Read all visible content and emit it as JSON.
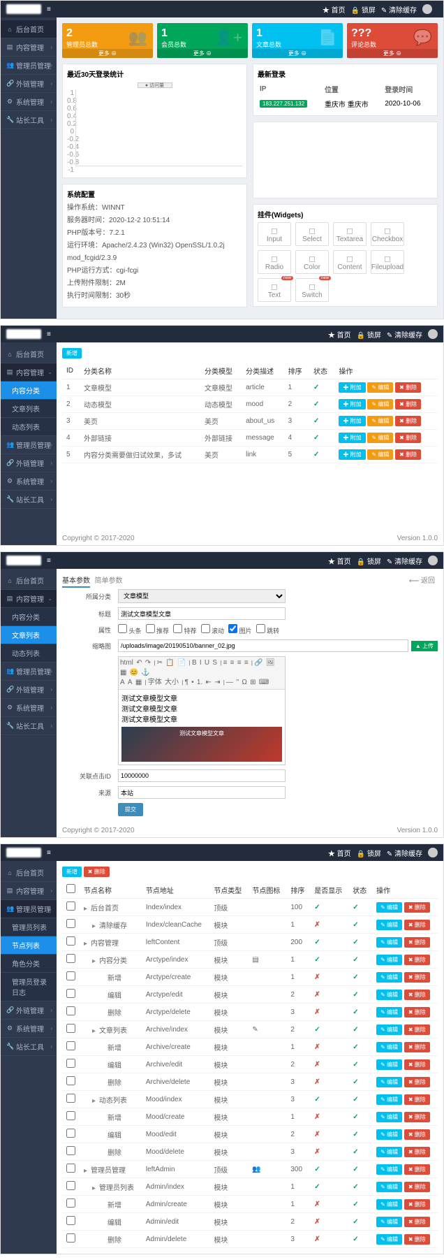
{
  "topbar": {
    "menu_icon": "≡",
    "home": "★ 首页",
    "lock": "🔒 锁屏",
    "clear": "✎ 清除缓存",
    "user": ""
  },
  "sidebar_common": {
    "dashboard": "后台首页",
    "content": "内容管理",
    "content_cat": "内容分类",
    "article_list": "文章列表",
    "dynamic_list": "动态列表",
    "admin": "管理员管理",
    "admin_list": "管理员列表",
    "node_list": "节点列表",
    "role_list": "角色分类",
    "admin_log": "管理员登录日志",
    "ext": "外链管理",
    "sys": "系统管理",
    "tools": "站长工具"
  },
  "shot1": {
    "cards": [
      {
        "num": "2",
        "label": "管理员总数",
        "color": "c-orange",
        "icon": "👥"
      },
      {
        "num": "1",
        "label": "会员总数",
        "color": "c-green",
        "icon": "👤+"
      },
      {
        "num": "1",
        "label": "文章总数",
        "color": "c-blue",
        "icon": "📄"
      },
      {
        "num": "???",
        "label": "评论总数",
        "color": "c-red",
        "icon": "💬"
      }
    ],
    "card_more": "更多 ⊕",
    "chart_title": "最近30天登录统计",
    "chart_legend": "● 访问量",
    "login_panel": "最新登录",
    "login_headers": {
      "ip": "IP",
      "loc": "位置",
      "time": "登录时间"
    },
    "login_row": {
      "ip": "183.227.251.132",
      "loc": "重庆市 重庆市",
      "time": "2020-10-06"
    },
    "sys_title": "系统配置",
    "sys_lines": [
      "操作系统：WINNT",
      "服务器时间：2020-12-2 10:51:14",
      "PHP版本号：7.2.1",
      "运行环境：Apache/2.4.23 (Win32) OpenSSL/1.0.2j mod_fcgid/2.3.9",
      "PHP运行方式：cgi-fcgi",
      "上传附件限制：2M",
      "执行时间限制：30秒"
    ],
    "widgets_title": "挂件(Widgets)",
    "widgets": [
      {
        "n": "Input",
        "new": false
      },
      {
        "n": "Select",
        "new": false
      },
      {
        "n": "Textarea",
        "new": false
      },
      {
        "n": "Checkbox",
        "new": false
      },
      {
        "n": "Radio",
        "new": false
      },
      {
        "n": "Color",
        "new": false
      },
      {
        "n": "Content",
        "new": false
      },
      {
        "n": "Fileupload",
        "new": false
      },
      {
        "n": "Text",
        "new": true
      },
      {
        "n": "Switch",
        "new": true
      }
    ],
    "chart_data": {
      "type": "line",
      "title": "最近30天登录统计",
      "series": [
        {
          "name": "访问量",
          "values": [
            0,
            0,
            0,
            0,
            0,
            0,
            0,
            0,
            0,
            0,
            0,
            0,
            0,
            0,
            0,
            0,
            0,
            0,
            0,
            0,
            0,
            0,
            0,
            0,
            0,
            0,
            0,
            0,
            0,
            0
          ]
        }
      ],
      "ylim": [
        -1,
        1
      ],
      "yticks": [
        -1,
        -0.8,
        -0.6,
        -0.4,
        -0.2,
        0,
        0.2,
        0.4,
        0.6,
        0.8,
        1
      ]
    }
  },
  "shot2": {
    "add_btn": "新增",
    "headers": {
      "id": "ID",
      "name": "分类名称",
      "type": "分类模型",
      "alias": "分类描述",
      "sort": "排序",
      "status": "状态",
      "op": "操作"
    },
    "rows": [
      {
        "id": "1",
        "name": "文章模型",
        "type": "文章模型",
        "alias": "article",
        "sort": "1",
        "status": true
      },
      {
        "id": "2",
        "name": "动态模型",
        "type": "动态模型",
        "alias": "mood",
        "sort": "2",
        "status": true
      },
      {
        "id": "3",
        "name": "美页",
        "type": "美页",
        "alias": "about_us",
        "sort": "3",
        "status": true
      },
      {
        "id": "4",
        "name": "外部链接",
        "type": "外部链接",
        "alias": "message",
        "sort": "4",
        "status": true
      },
      {
        "id": "5",
        "name": "内容分类需要做归试效果，多试",
        "type": "美页",
        "alias": "link",
        "sort": "5",
        "status": true
      }
    ],
    "op_labels": {
      "add": "✚ 附加",
      "edit": "✎ 编辑",
      "del": "✖ 删除"
    },
    "copyright": "Copyright © 2017-2020",
    "version": "Version 1.0.0"
  },
  "shot3": {
    "breadcrumb": [
      "基本参数",
      "简单参数"
    ],
    "labels": {
      "cat": "所属分类",
      "title": "标题",
      "attr": "属性",
      "thumb": "缩略图",
      "pv": "关联点击ID",
      "source": "来源"
    },
    "cat_value": "文章模型",
    "title_value": "测试文章模型文章",
    "attrs": [
      "头条",
      "推荐",
      "特荐",
      "滚动",
      "图片",
      "跳转"
    ],
    "thumb_path": "/uploads/image/20190510/banner_02.jpg",
    "upload_btn": "▲ 上传",
    "editor_lines": [
      "测试文章模型文章",
      "测试文章模型文章",
      "测试文章模型文章"
    ],
    "pv_value": "10000000",
    "source_value": "本站",
    "submit": "提交",
    "back": "⟵ 返回",
    "copyright": "Copyright © 2017-2020",
    "version": "Version 1.0.0"
  },
  "shot4": {
    "add_btn": "新增",
    "del_btn": "✖ 删除",
    "headers": {
      "name": "节点名称",
      "addr": "节点地址",
      "type": "节点类型",
      "icon": "节点图标",
      "sort": "排序",
      "show": "是否显示",
      "status": "状态",
      "op": "操作"
    },
    "op_labels": {
      "edit": "✎ 编辑",
      "del": "✖ 删除"
    },
    "rows": [
      {
        "lv": 0,
        "name": "后台首页",
        "addr": "Index/index",
        "type": "顶级",
        "icon": "",
        "sort": "100",
        "show": true,
        "status": true
      },
      {
        "lv": 1,
        "name": "清除缓存",
        "addr": "Index/cleanCache",
        "type": "模块",
        "icon": "",
        "sort": "1",
        "show": false,
        "status": true
      },
      {
        "lv": 0,
        "name": "内容管理",
        "addr": "leftContent",
        "type": "顶级",
        "icon": "",
        "sort": "200",
        "show": true,
        "status": true
      },
      {
        "lv": 1,
        "name": "内容分类",
        "addr": "Arctype/index",
        "type": "模块",
        "icon": "▤",
        "sort": "1",
        "show": true,
        "status": true
      },
      {
        "lv": 2,
        "name": "新增",
        "addr": "Arctype/create",
        "type": "模块",
        "icon": "",
        "sort": "1",
        "show": false,
        "status": true
      },
      {
        "lv": 2,
        "name": "编辑",
        "addr": "Arctype/edit",
        "type": "模块",
        "icon": "",
        "sort": "2",
        "show": false,
        "status": true
      },
      {
        "lv": 2,
        "name": "删除",
        "addr": "Arctype/delete",
        "type": "模块",
        "icon": "",
        "sort": "3",
        "show": false,
        "status": true
      },
      {
        "lv": 1,
        "name": "文章列表",
        "addr": "Archive/index",
        "type": "模块",
        "icon": "✎",
        "sort": "2",
        "show": true,
        "status": true
      },
      {
        "lv": 2,
        "name": "新增",
        "addr": "Archive/create",
        "type": "模块",
        "icon": "",
        "sort": "1",
        "show": false,
        "status": true
      },
      {
        "lv": 2,
        "name": "编辑",
        "addr": "Archive/edit",
        "type": "模块",
        "icon": "",
        "sort": "2",
        "show": false,
        "status": true
      },
      {
        "lv": 2,
        "name": "删除",
        "addr": "Archive/delete",
        "type": "模块",
        "icon": "",
        "sort": "3",
        "show": false,
        "status": true
      },
      {
        "lv": 1,
        "name": "动态列表",
        "addr": "Mood/index",
        "type": "模块",
        "icon": "",
        "sort": "3",
        "show": true,
        "status": true
      },
      {
        "lv": 2,
        "name": "新增",
        "addr": "Mood/create",
        "type": "模块",
        "icon": "",
        "sort": "1",
        "show": false,
        "status": true
      },
      {
        "lv": 2,
        "name": "编辑",
        "addr": "Mood/edit",
        "type": "模块",
        "icon": "",
        "sort": "2",
        "show": false,
        "status": true
      },
      {
        "lv": 2,
        "name": "删除",
        "addr": "Mood/delete",
        "type": "模块",
        "icon": "",
        "sort": "3",
        "show": false,
        "status": true
      },
      {
        "lv": 0,
        "name": "管理员管理",
        "addr": "leftAdmin",
        "type": "顶级",
        "icon": "👥",
        "sort": "300",
        "show": true,
        "status": true
      },
      {
        "lv": 1,
        "name": "管理员列表",
        "addr": "Admin/index",
        "type": "模块",
        "icon": "",
        "sort": "1",
        "show": true,
        "status": true
      },
      {
        "lv": 2,
        "name": "新增",
        "addr": "Admin/create",
        "type": "模块",
        "icon": "",
        "sort": "1",
        "show": false,
        "status": true
      },
      {
        "lv": 2,
        "name": "编辑",
        "addr": "Admin/edit",
        "type": "模块",
        "icon": "",
        "sort": "2",
        "show": false,
        "status": true
      },
      {
        "lv": 2,
        "name": "删除",
        "addr": "Admin/delete",
        "type": "模块",
        "icon": "",
        "sort": "3",
        "show": false,
        "status": true
      }
    ]
  }
}
